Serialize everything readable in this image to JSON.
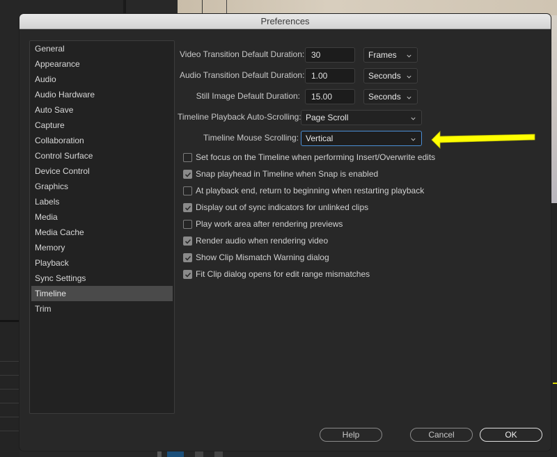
{
  "dialog": {
    "title": "Preferences"
  },
  "sidebar": {
    "items": [
      {
        "label": "General"
      },
      {
        "label": "Appearance"
      },
      {
        "label": "Audio"
      },
      {
        "label": "Audio Hardware"
      },
      {
        "label": "Auto Save"
      },
      {
        "label": "Capture"
      },
      {
        "label": "Collaboration"
      },
      {
        "label": "Control Surface"
      },
      {
        "label": "Device Control"
      },
      {
        "label": "Graphics"
      },
      {
        "label": "Labels"
      },
      {
        "label": "Media"
      },
      {
        "label": "Media Cache"
      },
      {
        "label": "Memory"
      },
      {
        "label": "Playback"
      },
      {
        "label": "Sync Settings"
      },
      {
        "label": "Timeline",
        "selected": true
      },
      {
        "label": "Trim"
      }
    ]
  },
  "timeline": {
    "video_transition": {
      "label": "Video Transition Default Duration:",
      "value": "30",
      "unit": "Frames"
    },
    "audio_transition": {
      "label": "Audio Transition Default Duration:",
      "value": "1.00",
      "unit": "Seconds"
    },
    "still_image": {
      "label": "Still Image Default Duration:",
      "value": "15.00",
      "unit": "Seconds"
    },
    "playback_autoscroll": {
      "label": "Timeline Playback Auto-Scrolling:",
      "value": "Page Scroll"
    },
    "mouse_scrolling": {
      "label": "Timeline Mouse Scrolling:",
      "value": "Vertical"
    },
    "checkboxes": [
      {
        "label": "Set focus on the Timeline when performing Insert/Overwrite edits",
        "checked": false
      },
      {
        "label": "Snap playhead in Timeline when Snap is enabled",
        "checked": true
      },
      {
        "label": "At playback end, return to beginning when restarting playback",
        "checked": false
      },
      {
        "label": "Display out of sync indicators for unlinked clips",
        "checked": true
      },
      {
        "label": "Play work area after rendering previews",
        "checked": false
      },
      {
        "label": "Render audio when rendering video",
        "checked": true
      },
      {
        "label": "Show Clip Mismatch Warning dialog",
        "checked": true
      },
      {
        "label": "Fit Clip dialog opens for edit range mismatches",
        "checked": true
      }
    ]
  },
  "buttons": {
    "help": "Help",
    "cancel": "Cancel",
    "ok": "OK"
  },
  "annotation": {
    "arrow_color": "#ffff00",
    "points_to": "Timeline Mouse Scrolling"
  },
  "colors": {
    "focus_border": "#4b8fd6",
    "selected_item_bg": "#4a4a4a"
  }
}
